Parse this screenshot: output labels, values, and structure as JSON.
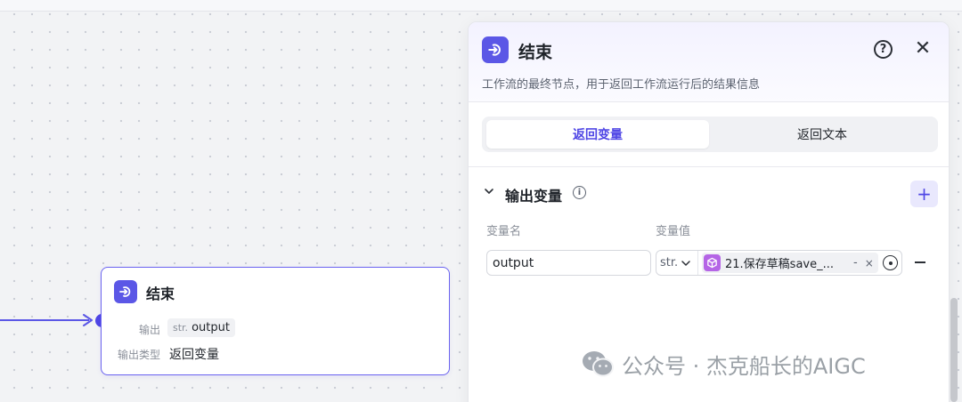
{
  "node": {
    "title": "结束",
    "output_label": "输出",
    "output_type_tag": "str.",
    "output_var": "output",
    "type_label": "输出类型",
    "type_value": "返回变量"
  },
  "panel": {
    "title": "结束",
    "description": "工作流的最终节点，用于返回工作流运行后的结果信息",
    "help_glyph": "?",
    "close_glyph": "✕",
    "tabs": [
      {
        "label": "返回变量",
        "active": true
      },
      {
        "label": "返回文本",
        "active": false
      }
    ],
    "section_title": "输出变量",
    "info_glyph": "i",
    "add_glyph": "+",
    "columns": {
      "name": "变量名",
      "value": "变量值"
    },
    "rows": [
      {
        "name": "output",
        "type": "str.",
        "reference": "21.保存草稿save_...",
        "ref_dash": "-",
        "ref_remove": "×"
      }
    ]
  },
  "watermark": {
    "text": "公众号 · 杰克船长的AIGC"
  },
  "colors": {
    "accent": "#5b57e6",
    "ref_icon": "#b565e6"
  }
}
